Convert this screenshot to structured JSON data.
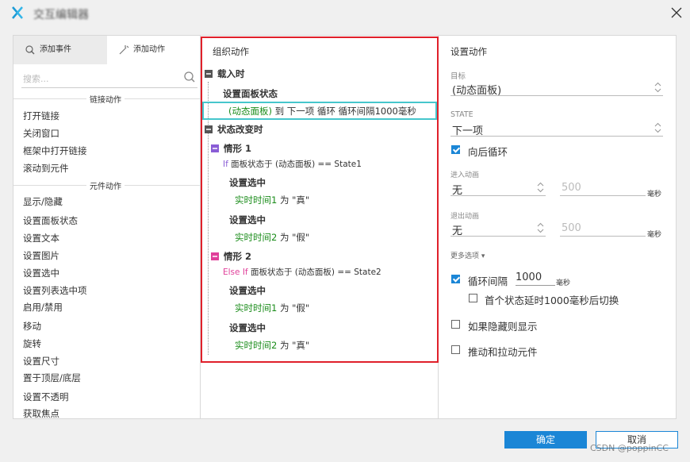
{
  "window": {
    "title": "交互编辑器",
    "close_icon": "close-icon",
    "logo_icon": "axure-x-logo"
  },
  "left": {
    "tabs": [
      {
        "label": "添加事件",
        "icon": "event-icon"
      },
      {
        "label": "添加动作",
        "icon": "sparkle-icon"
      }
    ],
    "search_placeholder": "搜索...",
    "sections": [
      {
        "label": "链接动作",
        "items": [
          "打开链接",
          "关闭窗口",
          "框架中打开链接",
          "滚动到元件"
        ]
      },
      {
        "label": "元件动作",
        "items": [
          "显示/隐藏",
          "设置面板状态",
          "设置文本",
          "设置图片",
          "设置选中",
          "设置列表选中项",
          "启用/禁用",
          "移动",
          "旋转",
          "设置尺寸",
          "置于顶层/底层",
          "设置不透明",
          "获取焦点"
        ]
      }
    ]
  },
  "middle": {
    "title": "组织动作",
    "events": [
      {
        "label": "载入时",
        "actions": [
          {
            "label": "设置面板状态",
            "detail": {
              "target": "(动态面板)",
              "text": " 到 下一项 循环 循环间隔1000毫秒"
            }
          }
        ]
      },
      {
        "label": "状态改变时",
        "cases": [
          {
            "label": "情形 1",
            "cond_kw": "If",
            "cond": " 面板状态于 (动态面板) == State1",
            "actions": [
              {
                "label": "设置选中",
                "target": "实时时间1",
                "text": " 为 \"真\""
              },
              {
                "label": "设置选中",
                "target": "实时时间2",
                "text": " 为 \"假\""
              }
            ]
          },
          {
            "label": "情形 2",
            "cond_kw": "Else If",
            "cond": " 面板状态于 (动态面板) == State2",
            "actions": [
              {
                "label": "设置选中",
                "target": "实时时间1",
                "text": " 为 \"假\""
              },
              {
                "label": "设置选中",
                "target": "实时时间2",
                "text": " 为 \"真\""
              }
            ]
          }
        ]
      }
    ]
  },
  "right": {
    "title": "设置动作",
    "target_label": "目标",
    "target_value": "(动态面板)",
    "state_label": "STATE",
    "state_value": "下一项",
    "loop_back_label": "向后循环",
    "loop_back_checked": true,
    "enter_anim_label": "进入动画",
    "enter_anim_value": "无",
    "enter_anim_ms": "500",
    "exit_anim_label": "退出动画",
    "exit_anim_value": "无",
    "exit_anim_ms": "500",
    "ms_unit": "毫秒",
    "more_options": "更多选项 ▾",
    "loop_interval_label": "循环间隔",
    "loop_interval_value": "1000",
    "loop_interval_checked": true,
    "first_delay_label": "首个状态延时1000毫秒后切换",
    "first_delay_checked": false,
    "show_if_hidden_label": "如果隐藏则显示",
    "show_if_hidden_checked": false,
    "push_pull_label": "推动和拉动元件",
    "push_pull_checked": false
  },
  "footer": {
    "ok_label": "确定",
    "cancel_label": "取消",
    "watermark": "CSDN @poppinCC"
  },
  "colors": {
    "accent": "#1b86d6",
    "highlight_box": "#e0202a",
    "selected_row": "#46c6cc",
    "case1": "#8a5dd6",
    "case2": "#e0409a",
    "value_green": "#1a8c1a"
  }
}
